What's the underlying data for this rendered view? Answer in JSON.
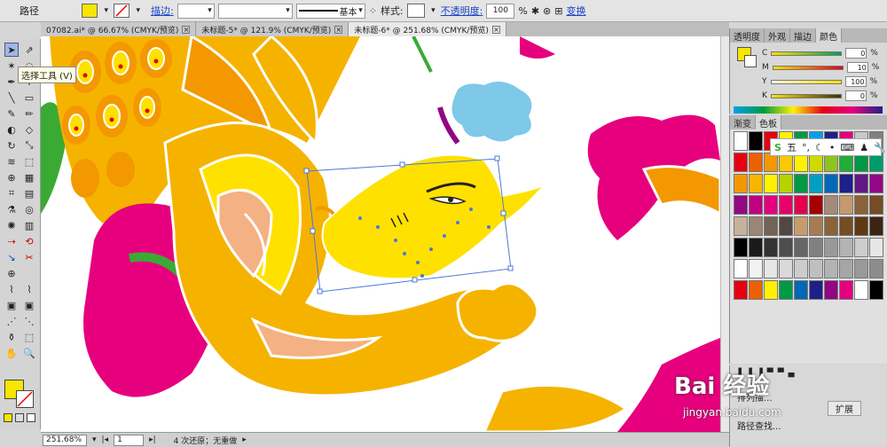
{
  "control_bar": {
    "path_label": "路径",
    "stroke_label": "描边:",
    "stroke_style": "基本",
    "style_label": "样式:",
    "opacity_label": "不透明度:",
    "opacity_value": "100",
    "percent": "%",
    "transform_label": "变换"
  },
  "tabs": [
    {
      "label": "07082.ai* @ 66.67% (CMYK/预览)"
    },
    {
      "label": "未标题-5* @ 121.9% (CMYK/预览)"
    },
    {
      "label": "未标题-6* @ 251.68% (CMYK/预览)"
    }
  ],
  "toolbox": {
    "tooltip": "选择工具 (V)"
  },
  "status_bar": {
    "zoom": "251.68%",
    "page": "1",
    "message": "4 次还原；无重做"
  },
  "color_panel": {
    "tabs": [
      "透明度",
      "外观",
      "描边",
      "颜色"
    ],
    "rows": [
      {
        "label": "C",
        "value": "0"
      },
      {
        "label": "M",
        "value": "10"
      },
      {
        "label": "Y",
        "value": "100"
      },
      {
        "label": "K",
        "value": "0"
      }
    ],
    "percent": "%"
  },
  "swatch_panel": {
    "tabs": [
      "渐变",
      "色板"
    ]
  },
  "ime_toolbar": {
    "label": "五"
  },
  "bottom_panel": {
    "label_1": "排列描...",
    "label_2": "扩展",
    "label_3": "路径查找..."
  },
  "watermark": {
    "text": "Bai 经验",
    "url": "jingyan.baidu.com"
  },
  "colors": {
    "fill": "#f7e600",
    "magenta": "#e6007e",
    "orange": "#f39800",
    "yellow": "#ffe100",
    "peach": "#f4b183",
    "blue_cloud": "#7ec8e8",
    "selection": "#4a78d8"
  },
  "swatches": [
    [
      "#ffffff",
      "#000000",
      "#e60012",
      "#fff100",
      "#009944",
      "#00a0e9",
      "#1d2088",
      "#e4007f",
      "#c8c8c8",
      "#808080"
    ],
    [
      "#e60012",
      "#eb6100",
      "#f39800",
      "#fcc800",
      "#fff100",
      "#cfdb00",
      "#8fc31f",
      "#22ac38",
      "#009944",
      "#009b6b"
    ],
    [
      "#f39800",
      "#f8b500",
      "#fff100",
      "#b8d200",
      "#009944",
      "#00a0c1",
      "#0068b7",
      "#1d2088",
      "#601986",
      "#920783"
    ],
    [
      "#920783",
      "#be0081",
      "#e4007f",
      "#e5006a",
      "#e5004f",
      "#a40000",
      "#a48b78",
      "#c49a6c",
      "#8c6239",
      "#754c24"
    ],
    [
      "#c7b299",
      "#998675",
      "#736357",
      "#534741",
      "#c69c6d",
      "#a67c52",
      "#8c6239",
      "#754c24",
      "#603913",
      "#3c2415"
    ],
    [
      "#000000",
      "#1a1a1a",
      "#333333",
      "#4d4d4d",
      "#666666",
      "#808080",
      "#999999",
      "#b3b3b3",
      "#cccccc",
      "#e6e6e6"
    ],
    [
      "#ffffff",
      "#f2f2f2",
      "#e6e6e6",
      "#d9d9d9",
      "#cccccc",
      "#bfbfbf",
      "#b3b3b3",
      "#a6a6a6",
      "#999999",
      "#8c8c8c"
    ],
    [
      "#e60012",
      "#eb6100",
      "#fff100",
      "#009944",
      "#0068b7",
      "#1d2088",
      "#920783",
      "#e4007f",
      "#ffffff",
      "#000000"
    ]
  ]
}
